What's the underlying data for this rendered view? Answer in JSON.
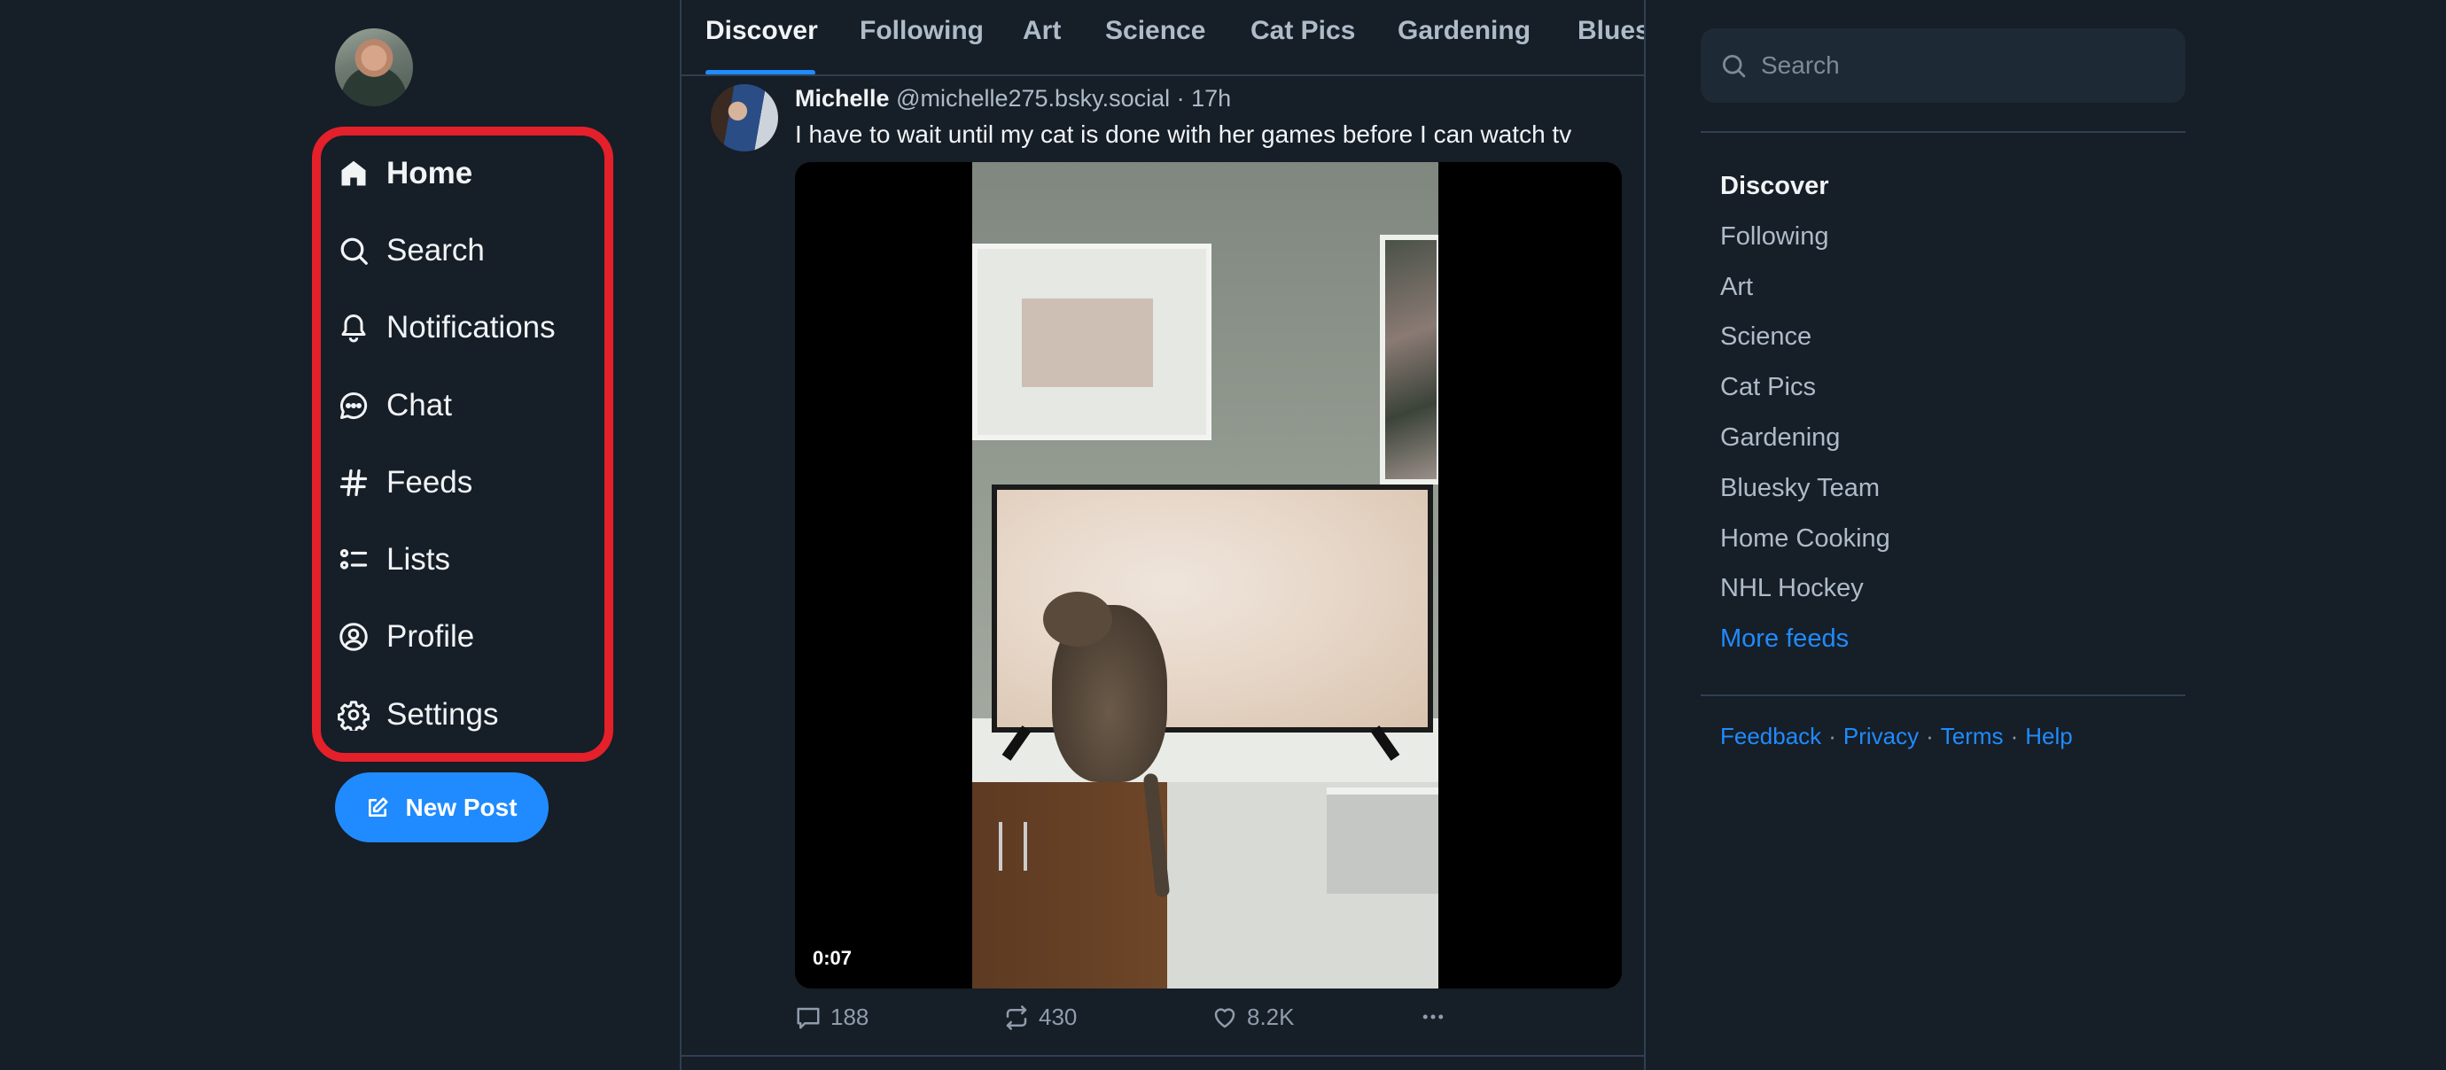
{
  "app": {
    "name": "Bluesky",
    "accent_color": "#208bfe",
    "highlight_color": "#e4202a"
  },
  "nav": {
    "items": [
      {
        "id": "home",
        "label": "Home",
        "icon": "home-icon",
        "active": true
      },
      {
        "id": "search",
        "label": "Search",
        "icon": "search-icon",
        "active": false
      },
      {
        "id": "notifications",
        "label": "Notifications",
        "icon": "bell-icon",
        "active": false
      },
      {
        "id": "chat",
        "label": "Chat",
        "icon": "chat-bubble-icon",
        "active": false
      },
      {
        "id": "feeds",
        "label": "Feeds",
        "icon": "hashtag-icon",
        "active": false
      },
      {
        "id": "lists",
        "label": "Lists",
        "icon": "list-icon",
        "active": false
      },
      {
        "id": "profile",
        "label": "Profile",
        "icon": "user-circle-icon",
        "active": false
      },
      {
        "id": "settings",
        "label": "Settings",
        "icon": "gear-icon",
        "active": false
      }
    ],
    "new_post_label": "New Post"
  },
  "tabs": [
    {
      "label": "Discover",
      "active": true
    },
    {
      "label": "Following",
      "active": false
    },
    {
      "label": "Art",
      "active": false
    },
    {
      "label": "Science",
      "active": false
    },
    {
      "label": "Cat Pics",
      "active": false
    },
    {
      "label": "Gardening",
      "active": false
    },
    {
      "label": "Bluesky Team",
      "active": false
    }
  ],
  "post": {
    "author_name": "Michelle",
    "author_handle": "@michelle275.bsky.social",
    "separator": " · ",
    "time_ago": "17h",
    "text": "I have to wait until my cat is done with her games before I can watch tv",
    "video_duration": "0:07",
    "replies": "188",
    "reposts": "430",
    "likes": "8.2K"
  },
  "right": {
    "search_placeholder": "Search",
    "feeds": [
      {
        "label": "Discover",
        "active": true
      },
      {
        "label": "Following",
        "active": false
      },
      {
        "label": "Art",
        "active": false
      },
      {
        "label": "Science",
        "active": false
      },
      {
        "label": "Cat Pics",
        "active": false
      },
      {
        "label": "Gardening",
        "active": false
      },
      {
        "label": "Bluesky Team",
        "active": false
      },
      {
        "label": "Home Cooking",
        "active": false
      },
      {
        "label": "NHL Hockey",
        "active": false
      }
    ],
    "more_feeds_label": "More feeds",
    "footer_links": [
      "Feedback",
      "Privacy",
      "Terms",
      "Help"
    ],
    "footer_separator": "·"
  }
}
